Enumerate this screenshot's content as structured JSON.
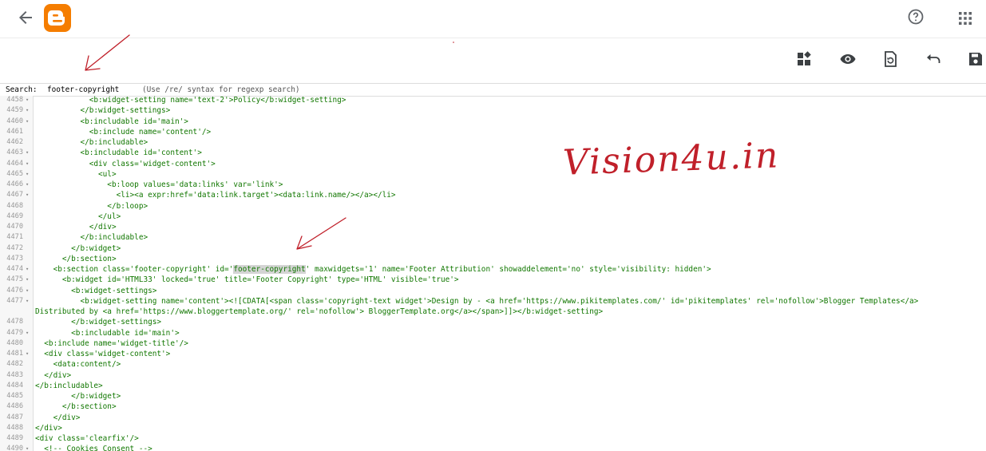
{
  "header": {
    "back_icon": "arrow-left-icon",
    "logo_icon": "blogger-logo-icon",
    "help_icon": "help-circle-icon",
    "apps_icon": "apps-grid-icon"
  },
  "toolbar": {
    "icons": [
      "widgets-icon",
      "preview-eye-icon",
      "restore-icon",
      "undo-icon",
      "save-icon"
    ]
  },
  "search": {
    "label": "Search:",
    "value": "footer-copyright",
    "hint": "(Use /re/ syntax for regexp search)"
  },
  "watermark": "Vision4u.in",
  "colors": {
    "logo": "#f57d00",
    "annotation": "#c0202a",
    "code": "#117700",
    "highlight": "#d4d4d4"
  },
  "editor": {
    "lines": [
      {
        "n": "4458",
        "fold": true,
        "text": "            <b:widget-setting name='text-2'>Policy</b:widget-setting>"
      },
      {
        "n": "4459",
        "fold": true,
        "text": "          </b:widget-settings>"
      },
      {
        "n": "4460",
        "fold": true,
        "text": "          <b:includable id='main'>"
      },
      {
        "n": "4461",
        "fold": false,
        "text": "            <b:include name='content'/>"
      },
      {
        "n": "4462",
        "fold": false,
        "text": "          </b:includable>"
      },
      {
        "n": "4463",
        "fold": true,
        "text": "          <b:includable id='content'>"
      },
      {
        "n": "4464",
        "fold": true,
        "text": "            <div class='widget-content'>"
      },
      {
        "n": "4465",
        "fold": true,
        "text": "              <ul>"
      },
      {
        "n": "4466",
        "fold": true,
        "text": "                <b:loop values='data:links' var='link'>"
      },
      {
        "n": "4467",
        "fold": true,
        "text": "                  <li><a expr:href='data:link.target'><data:link.name/></a></li>"
      },
      {
        "n": "4468",
        "fold": false,
        "text": "                </b:loop>"
      },
      {
        "n": "4469",
        "fold": false,
        "text": "              </ul>"
      },
      {
        "n": "4470",
        "fold": false,
        "text": "            </div>"
      },
      {
        "n": "4471",
        "fold": false,
        "text": "          </b:includable>"
      },
      {
        "n": "4472",
        "fold": false,
        "text": "        </b:widget>"
      },
      {
        "n": "4473",
        "fold": false,
        "text": "      </b:section>"
      },
      {
        "n": "4474",
        "fold": true,
        "pre": "    <b:section class='footer-copyright' id='",
        "hl": "footer-copyright",
        "post": "' maxwidgets='1' name='Footer Attribution' showaddelement='no' style='visibility: hidden'>"
      },
      {
        "n": "4475",
        "fold": true,
        "text": "      <b:widget id='HTML33' locked='true' title='Footer Copyright' type='HTML' visible='true'>"
      },
      {
        "n": "4476",
        "fold": true,
        "text": "        <b:widget-settings>"
      },
      {
        "n": "4477",
        "fold": true,
        "text": "          <b:widget-setting name='content'><![CDATA[<span class='copyright-text widget'>Design by - <a href='https://www.pikitemplates.com/' id='pikitemplates' rel='nofollow'>Blogger Templates</a>"
      },
      {
        "n": "",
        "fold": false,
        "text": "Distributed by <a href='https://www.bloggertemplate.org/' rel='nofollow'> BloggerTemplate.org</a></span>]]></b:widget-setting>"
      },
      {
        "n": "4478",
        "fold": false,
        "text": "        </b:widget-settings>"
      },
      {
        "n": "4479",
        "fold": true,
        "text": "        <b:includable id='main'>"
      },
      {
        "n": "4480",
        "fold": false,
        "text": "  <b:include name='widget-title'/>"
      },
      {
        "n": "4481",
        "fold": true,
        "text": "  <div class='widget-content'>"
      },
      {
        "n": "4482",
        "fold": false,
        "text": "    <data:content/>"
      },
      {
        "n": "4483",
        "fold": false,
        "text": "  </div>"
      },
      {
        "n": "4484",
        "fold": false,
        "text": "</b:includable>"
      },
      {
        "n": "4485",
        "fold": false,
        "text": "        </b:widget>"
      },
      {
        "n": "4486",
        "fold": false,
        "text": "      </b:section>"
      },
      {
        "n": "4487",
        "fold": false,
        "text": "    </div>"
      },
      {
        "n": "4488",
        "fold": false,
        "text": "</div>"
      },
      {
        "n": "4489",
        "fold": false,
        "text": "<div class='clearfix'/>"
      },
      {
        "n": "4490",
        "fold": true,
        "text": "  <!-- Cookies Consent -->"
      }
    ]
  }
}
